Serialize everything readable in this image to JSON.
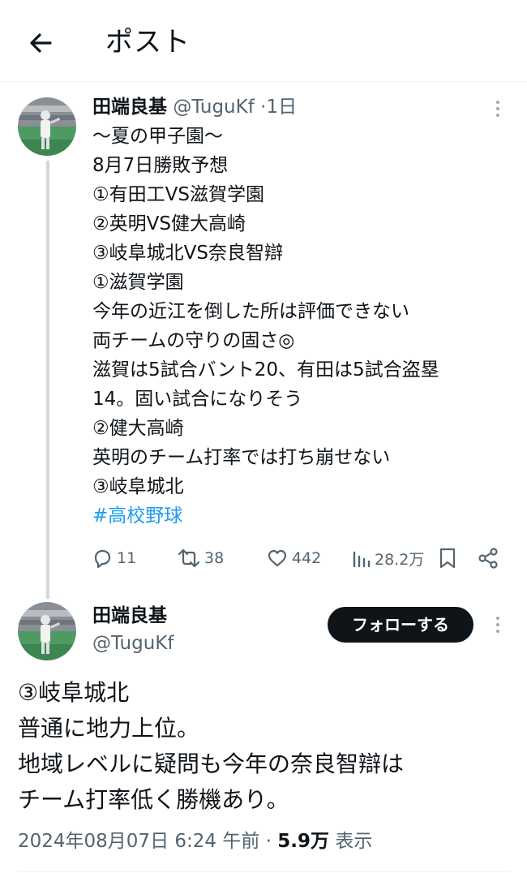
{
  "header": {
    "title": "ポスト",
    "back_icon": "arrow-left-icon"
  },
  "post1": {
    "author_name": "田端良基",
    "handle": "@TuguKf",
    "separator": "·",
    "time": "1日",
    "lines": [
      "〜夏の甲子園〜",
      "8月7日勝敗予想",
      "①有田工VS滋賀学園",
      "②英明VS健大高崎",
      "③岐阜城北VS奈良智辯",
      "①滋賀学園",
      "今年の近江を倒した所は評価できない",
      "両チームの守りの固さ◎",
      "滋賀は5試合バント20、有田は5試合盗塁",
      "14。固い試合になりそう",
      "②健大高崎",
      "英明のチーム打率では打ち崩せない",
      "③岐阜城北"
    ],
    "hashtag": "#高校野球",
    "actions": {
      "reply_count": "11",
      "repost_count": "38",
      "like_count": "442",
      "views_count": "28.2万"
    }
  },
  "post2": {
    "author_name": "田端良基",
    "handle": "@TuguKf",
    "follow_label": "フォローする",
    "lines": [
      "③岐阜城北",
      "普通に地力上位。",
      "地域レベルに疑問も今年の奈良智辯は",
      "チーム打率低く勝機あり。"
    ],
    "timestamp": "2024年08月07日 6:24 午前",
    "dot": " · ",
    "views_value": "5.9万",
    "views_label": " 表示"
  },
  "colors": {
    "accent": "#1d9bf0",
    "text": "#0f1419",
    "muted": "#536471",
    "button": "#0f1419"
  }
}
